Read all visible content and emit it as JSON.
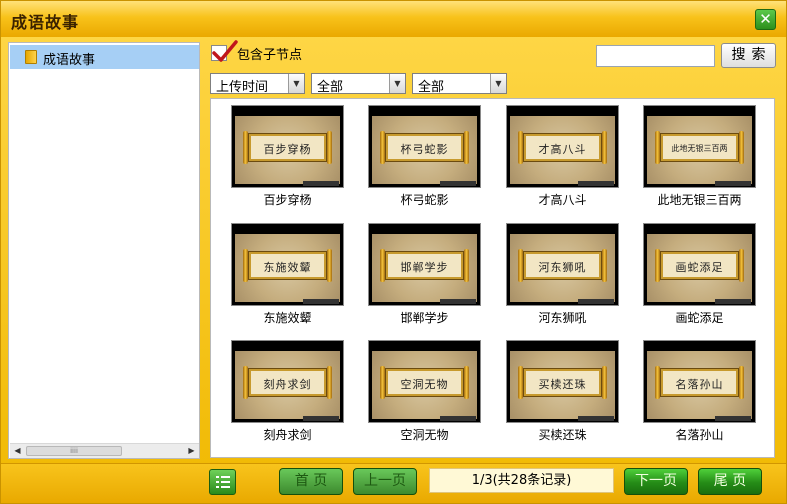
{
  "window": {
    "title": "成语故事",
    "close_label": "✕"
  },
  "tree": {
    "items": [
      {
        "label": "成语故事",
        "icon": "folder-icon"
      }
    ],
    "scroll_thumb": "iiii"
  },
  "filter": {
    "include_children_label": "包含子节点",
    "include_children_checked": true
  },
  "search": {
    "placeholder": "",
    "button_label": "搜索"
  },
  "selects": [
    {
      "value": "上传时间"
    },
    {
      "value": "全部"
    },
    {
      "value": "全部"
    }
  ],
  "items": [
    {
      "title": "百步穿杨",
      "art": "百步穿杨"
    },
    {
      "title": "杯弓蛇影",
      "art": "杯弓蛇影"
    },
    {
      "title": "才高八斗",
      "art": "才高八斗"
    },
    {
      "title": "此地无银三百两",
      "art": "此地无银三百两"
    },
    {
      "title": "东施效颦",
      "art": "东施效颦"
    },
    {
      "title": "邯郸学步",
      "art": "邯郸学步"
    },
    {
      "title": "河东狮吼",
      "art": "河东狮吼"
    },
    {
      "title": "画蛇添足",
      "art": "画蛇添足"
    },
    {
      "title": "刻舟求剑",
      "art": "刻舟求剑"
    },
    {
      "title": "空洞无物",
      "art": "空洞无物"
    },
    {
      "title": "买椟还珠",
      "art": "买椟还珠"
    },
    {
      "title": "名落孙山",
      "art": "名落孙山"
    }
  ],
  "pagination": {
    "first_label": "首 页",
    "prev_label": "上一页",
    "info": "1/3(共28条记录)",
    "next_label": "下一页",
    "last_label": "尾 页"
  },
  "colors": {
    "accent": "#f0b800",
    "button_green": "#258c17",
    "selection": "#a6cff5"
  }
}
